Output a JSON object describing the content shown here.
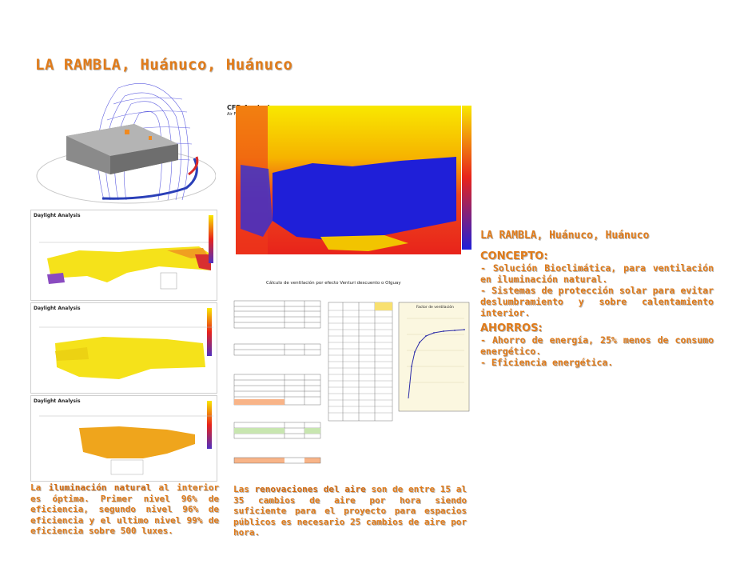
{
  "title": "LA RAMBLA, Huánuco, Huánuco",
  "colors": {
    "accent": "#e07b1a",
    "cfd_blue": "#1f1fd8",
    "cfd_red": "#e8231b",
    "cfd_yellow": "#f8e800"
  },
  "right": {
    "title": "LA RAMBLA, Huánuco, Huánuco",
    "concepto_heading": "CONCEPTO:",
    "concepto_1": "- Solución Bioclimática, para ventilación en iluminación natural.",
    "concepto_2": "- Sistemas de protección solar para evitar deslumbramiento y sobre calentamiento interior.",
    "ahorros_heading": "AHORROS:",
    "ahorros_1": "- Ahorro de energía, 25% menos de consumo energético.",
    "ahorros_2": "- Eficiencia energética."
  },
  "captions": {
    "left_pre": "La ",
    "left_bold": "iluminación natural",
    "left_post": " al interior es óptima. Primer nivel 96% de eficiencia, segundo nivel 96% de eficiencia y el ultimo nivel 99% de eficiencia sobre 500 luxes.",
    "mid_pre": "Las ",
    "mid_bold": "renovaciones del aire",
    "mid_post": " son de entre 15 al 35 cambios de aire por hora siendo suficiente para el proyecto para espacios públicos es necesario 25 cambios de aire por hora."
  },
  "cfd": {
    "label": "CFD Analysis",
    "sub": "Air Flow Rate"
  },
  "daylight": {
    "label": "Daylight Analysis"
  },
  "calc": {
    "title": "Cálculo de ventilación por efecto Venturi descuento o Olguay",
    "chart_title": "Factor de ventilación"
  }
}
